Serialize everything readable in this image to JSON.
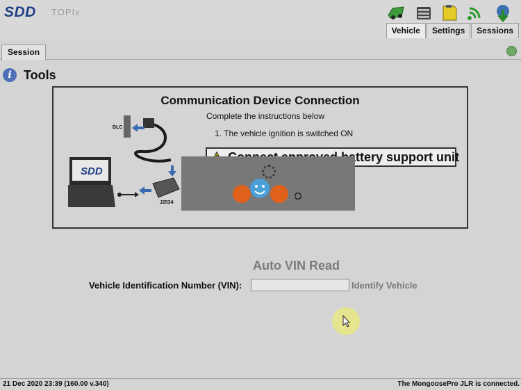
{
  "header": {
    "logo": "SDD",
    "product": "TOPIx",
    "icons": [
      "vehicle-icon",
      "settings-icon",
      "sessions-icon",
      "signal-icon",
      "download-icon"
    ],
    "tabs": [
      {
        "label": "Vehicle",
        "active": true
      },
      {
        "label": "Settings",
        "active": false
      },
      {
        "label": "Sessions",
        "active": false
      }
    ]
  },
  "session": {
    "tab_label": "Session"
  },
  "tools": {
    "title": "Tools"
  },
  "connection": {
    "title": "Communication Device Connection",
    "subtitle": "Complete the instructions below",
    "step_number": "1.",
    "step_text": "The vehicle ignition is switched ON",
    "warning_text": "Connect approved battery support unit",
    "diagram_labels": {
      "laptop": "SDD",
      "dlc": "DLC",
      "interface": "J2534"
    }
  },
  "vin": {
    "title": "Auto VIN Read",
    "label": "Vehicle Identification Number (VIN):",
    "value": "",
    "identify_label": "Identify Vehicle"
  },
  "status": {
    "left": "21 Dec 2020 23:39 (160.00 v.340)",
    "right": "The MongoosePro JLR is connected."
  },
  "colors": {
    "brand": "#1f3f86",
    "background": "#d4d4d4",
    "overlay": "#787878",
    "watermark": "#e0621a"
  }
}
